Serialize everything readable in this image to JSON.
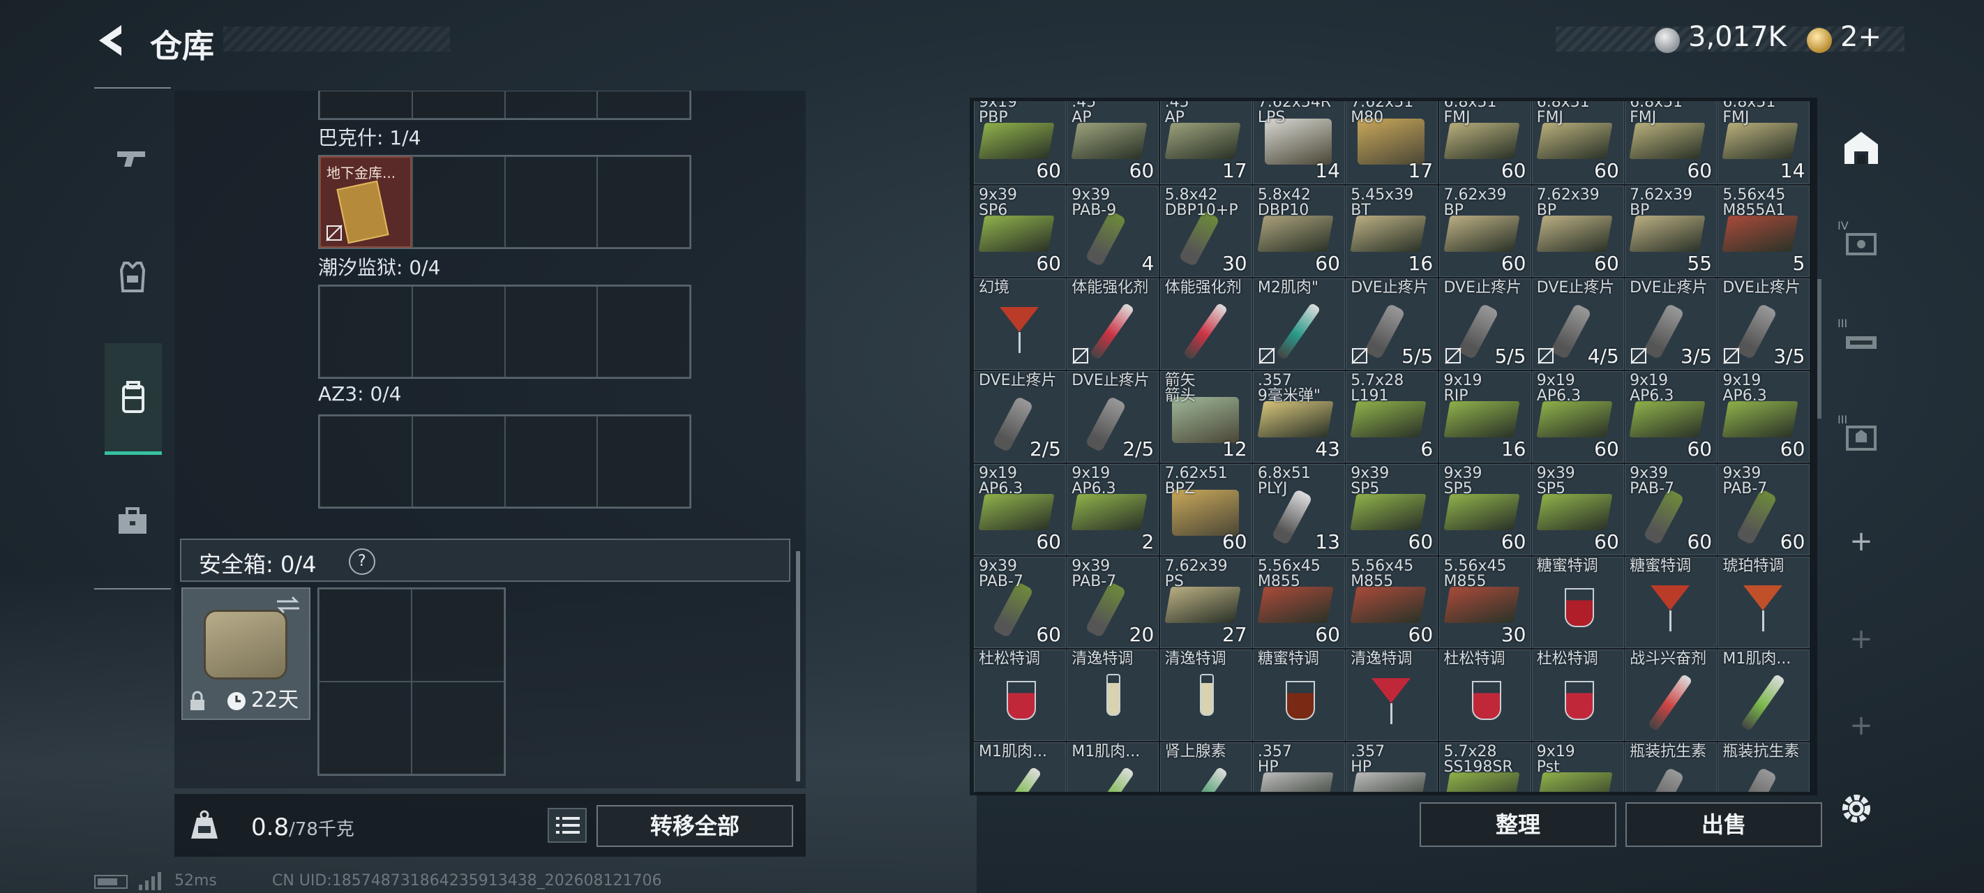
{
  "header": {
    "title": "仓库",
    "currency1": "3,017K",
    "currency2": "2+"
  },
  "stash": {
    "containers": [
      {
        "label": "巴克什: 1/4",
        "item_name": "地下金库..."
      },
      {
        "label": "潮汐监狱: 0/4"
      },
      {
        "label": "AZ3: 0/4"
      }
    ],
    "safe_label": "安全箱: 0/4",
    "safe_help": "?",
    "safe_timer": "22天",
    "weight_value": "0.8",
    "weight_max": "/78千克",
    "transfer_all": "转移全部"
  },
  "grid_items": [
    {
      "n": "9x19\nPBP",
      "q": "60",
      "t": "ammo",
      "c": "#8fb04a"
    },
    {
      "n": ".45\nAP",
      "q": "60",
      "t": "ammo",
      "c": "#9aa07a"
    },
    {
      "n": ".45\nAP",
      "q": "17",
      "t": "ammo",
      "c": "#9aa07a"
    },
    {
      "n": "7.62x54R\nLPS",
      "q": "14",
      "t": "bigbox",
      "c": "#d8d8d2"
    },
    {
      "n": "7.62x51\nM80",
      "q": "17",
      "t": "bigbox",
      "c": "#c9a85a"
    },
    {
      "n": "6.8x51\nFMJ",
      "q": "60",
      "t": "ammo",
      "c": "#b6ad7a"
    },
    {
      "n": "6.8x51\nFMJ",
      "q": "60",
      "t": "ammo",
      "c": "#b6ad7a"
    },
    {
      "n": "6.8x51\nFMJ",
      "q": "60",
      "t": "ammo",
      "c": "#b6ad7a"
    },
    {
      "n": "6.8x51\nFMJ",
      "q": "14",
      "t": "ammo",
      "c": "#b6ad7a"
    },
    {
      "n": "9x39\nSP6",
      "q": "60",
      "t": "ammo",
      "c": "#8fb04a"
    },
    {
      "n": "9x39\nPAB-9",
      "q": "4",
      "t": "pill",
      "c": "#6e8a3a"
    },
    {
      "n": "5.8x42\nDBP10+P",
      "q": "30",
      "t": "pill",
      "c": "#6e8a3a"
    },
    {
      "n": "5.8x42\nDBP10",
      "q": "60",
      "t": "ammo",
      "c": "#a9a07a"
    },
    {
      "n": "5.45x39\nBT",
      "q": "16",
      "t": "ammo",
      "c": "#b9ad82"
    },
    {
      "n": "7.62x39\nBP",
      "q": "60",
      "t": "ammo",
      "c": "#b9ad82"
    },
    {
      "n": "7.62x39\nBP",
      "q": "60",
      "t": "ammo",
      "c": "#b9ad82"
    },
    {
      "n": "7.62x39\nBP",
      "q": "55",
      "t": "ammo",
      "c": "#b9ad82"
    },
    {
      "n": "5.56x45\nM855A1",
      "q": "5",
      "t": "ammo",
      "c": "#a84a3a"
    },
    {
      "n": "幻境",
      "q": "",
      "t": "cocktail",
      "c": "#b93b28"
    },
    {
      "n": "体能强化剂",
      "q": "",
      "t": "syr",
      "c": "#cc3344",
      "lock": true
    },
    {
      "n": "体能强化剂",
      "q": "",
      "t": "syr",
      "c": "#cc3344"
    },
    {
      "n": "M2肌肉\"",
      "q": "",
      "t": "syr",
      "c": "#2a9a8a",
      "lock": true
    },
    {
      "n": "DVE止疼片",
      "q": "5/5",
      "t": "pill",
      "c": "#999",
      "lock": true
    },
    {
      "n": "DVE止疼片",
      "q": "5/5",
      "t": "pill",
      "c": "#999",
      "lock": true
    },
    {
      "n": "DVE止疼片",
      "q": "4/5",
      "t": "pill",
      "c": "#999",
      "lock": true
    },
    {
      "n": "DVE止疼片",
      "q": "3/5",
      "t": "pill",
      "c": "#999",
      "lock": true
    },
    {
      "n": "DVE止疼片",
      "q": "3/5",
      "t": "pill",
      "c": "#999",
      "lock": true
    },
    {
      "n": "DVE止疼片",
      "q": "2/5",
      "t": "pill",
      "c": "#999"
    },
    {
      "n": "DVE止疼片",
      "q": "2/5",
      "t": "pill",
      "c": "#999"
    },
    {
      "n": "箭矢\n箭头",
      "q": "12",
      "t": "bigbox",
      "c": "#9fb89a"
    },
    {
      "n": ".357\n9毫米弹\"",
      "q": "43",
      "t": "ammo",
      "c": "#d4c27a"
    },
    {
      "n": "5.7x28\nL191",
      "q": "6",
      "t": "ammo",
      "c": "#8fb04a"
    },
    {
      "n": "9x19\nRIP",
      "q": "16",
      "t": "ammo",
      "c": "#8fb04a"
    },
    {
      "n": "9x19\nAP6.3",
      "q": "60",
      "t": "ammo",
      "c": "#8fb04a"
    },
    {
      "n": "9x19\nAP6.3",
      "q": "60",
      "t": "ammo",
      "c": "#8fb04a"
    },
    {
      "n": "9x19\nAP6.3",
      "q": "60",
      "t": "ammo",
      "c": "#8fb04a"
    },
    {
      "n": "9x19\nAP6.3",
      "q": "60",
      "t": "ammo",
      "c": "#8fb04a"
    },
    {
      "n": "9x19\nAP6.3",
      "q": "2",
      "t": "ammo",
      "c": "#8fb04a"
    },
    {
      "n": "7.62x51\nBPZ",
      "q": "60",
      "t": "bigbox",
      "c": "#c9a85a"
    },
    {
      "n": "6.8x51\nPLYJ",
      "q": "13",
      "t": "pill",
      "c": "#ddd"
    },
    {
      "n": "9x39\nSP5",
      "q": "60",
      "t": "ammo",
      "c": "#8fb04a"
    },
    {
      "n": "9x39\nSP5",
      "q": "60",
      "t": "ammo",
      "c": "#8fb04a"
    },
    {
      "n": "9x39\nSP5",
      "q": "60",
      "t": "ammo",
      "c": "#8fb04a"
    },
    {
      "n": "9x39\nPAB-7",
      "q": "60",
      "t": "pill",
      "c": "#6e8a3a"
    },
    {
      "n": "9x39\nPAB-7",
      "q": "60",
      "t": "pill",
      "c": "#6e8a3a"
    },
    {
      "n": "9x39\nPAB-7",
      "q": "60",
      "t": "pill",
      "c": "#6e8a3a"
    },
    {
      "n": "9x39\nPAB-7",
      "q": "20",
      "t": "pill",
      "c": "#6e8a3a"
    },
    {
      "n": "7.62x39\nPS",
      "q": "27",
      "t": "ammo",
      "c": "#b9ad82"
    },
    {
      "n": "5.56x45\nM855",
      "q": "60",
      "t": "ammo",
      "c": "#a84a3a"
    },
    {
      "n": "5.56x45\nM855",
      "q": "60",
      "t": "ammo",
      "c": "#a84a3a"
    },
    {
      "n": "5.56x45\nM855",
      "q": "30",
      "t": "ammo",
      "c": "#a84a3a"
    },
    {
      "n": "糖蜜特调",
      "q": "",
      "t": "glass",
      "c": "#b01e2a"
    },
    {
      "n": "糖蜜特调",
      "q": "",
      "t": "cocktail",
      "c": "#b93b28"
    },
    {
      "n": "琥珀特调",
      "q": "",
      "t": "cocktail",
      "c": "#c0502a"
    },
    {
      "n": "杜松特调",
      "q": "",
      "t": "glass",
      "c": "#c0283a"
    },
    {
      "n": "清逸特调",
      "q": "",
      "t": "flute",
      "c": "#d9d2b0"
    },
    {
      "n": "清逸特调",
      "q": "",
      "t": "flute",
      "c": "#d9d2b0"
    },
    {
      "n": "糖蜜特调",
      "q": "",
      "t": "glass",
      "c": "#7a2a14"
    },
    {
      "n": "清逸特调",
      "q": "",
      "t": "cocktail",
      "c": "#c0283a"
    },
    {
      "n": "杜松特调",
      "q": "",
      "t": "glass",
      "c": "#c0283a"
    },
    {
      "n": "杜松特调",
      "q": "",
      "t": "glass",
      "c": "#c0283a"
    },
    {
      "n": "战斗兴奋剂",
      "q": "",
      "t": "syr",
      "c": "#c44"
    },
    {
      "n": "M1肌肉...",
      "q": "",
      "t": "syr",
      "c": "#7ab84a"
    },
    {
      "n": "M1肌肉...",
      "q": "",
      "t": "syr",
      "c": "#7ab84a"
    },
    {
      "n": "M1肌肉...",
      "q": "",
      "t": "syr",
      "c": "#7ab84a"
    },
    {
      "n": "肾上腺素",
      "q": "",
      "t": "syr",
      "c": "#4a9a6a"
    },
    {
      "n": ".357\nHP",
      "q": "",
      "t": "ammo",
      "c": "#bbb"
    },
    {
      "n": ".357\nHP",
      "q": "",
      "t": "ammo",
      "c": "#bbb"
    },
    {
      "n": "5.7x28\nSS198SR",
      "q": "",
      "t": "ammo",
      "c": "#8fb04a"
    },
    {
      "n": "9x19\nPst",
      "q": "",
      "t": "ammo",
      "c": "#8fb04a"
    },
    {
      "n": "瓶装抗生素",
      "q": "",
      "t": "pill",
      "c": "#999"
    },
    {
      "n": "瓶装抗生素",
      "q": "",
      "t": "pill",
      "c": "#999"
    }
  ],
  "grid_buttons": {
    "sort": "整理",
    "sell": "出售"
  },
  "right_nav": {
    "tier1": "IV",
    "tier2": "III",
    "tier3": "III"
  },
  "status": {
    "ping": "52ms",
    "uid": "CN UID:185748731864235913438_202608121706"
  }
}
